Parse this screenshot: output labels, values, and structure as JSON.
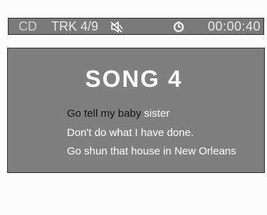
{
  "status_bar": {
    "source": "CD",
    "track": "TRK 4/9",
    "mute_icon": "mute-icon",
    "clock_icon": "clock-icon",
    "time": "00:00:40"
  },
  "song": {
    "title": "SONG 4",
    "lines": [
      {
        "sung": "Go tell my baby",
        "remaining": " sister"
      },
      {
        "sung": "",
        "remaining": "Don't do what I have done."
      },
      {
        "sung": "",
        "remaining": "Go shun that house in New Orleans"
      }
    ]
  },
  "colors": {
    "panel_bg": "#7f7f7f",
    "status_bg": "#7a7a7a",
    "sung_text": "#141414",
    "unsung_text": "#ffffff"
  }
}
